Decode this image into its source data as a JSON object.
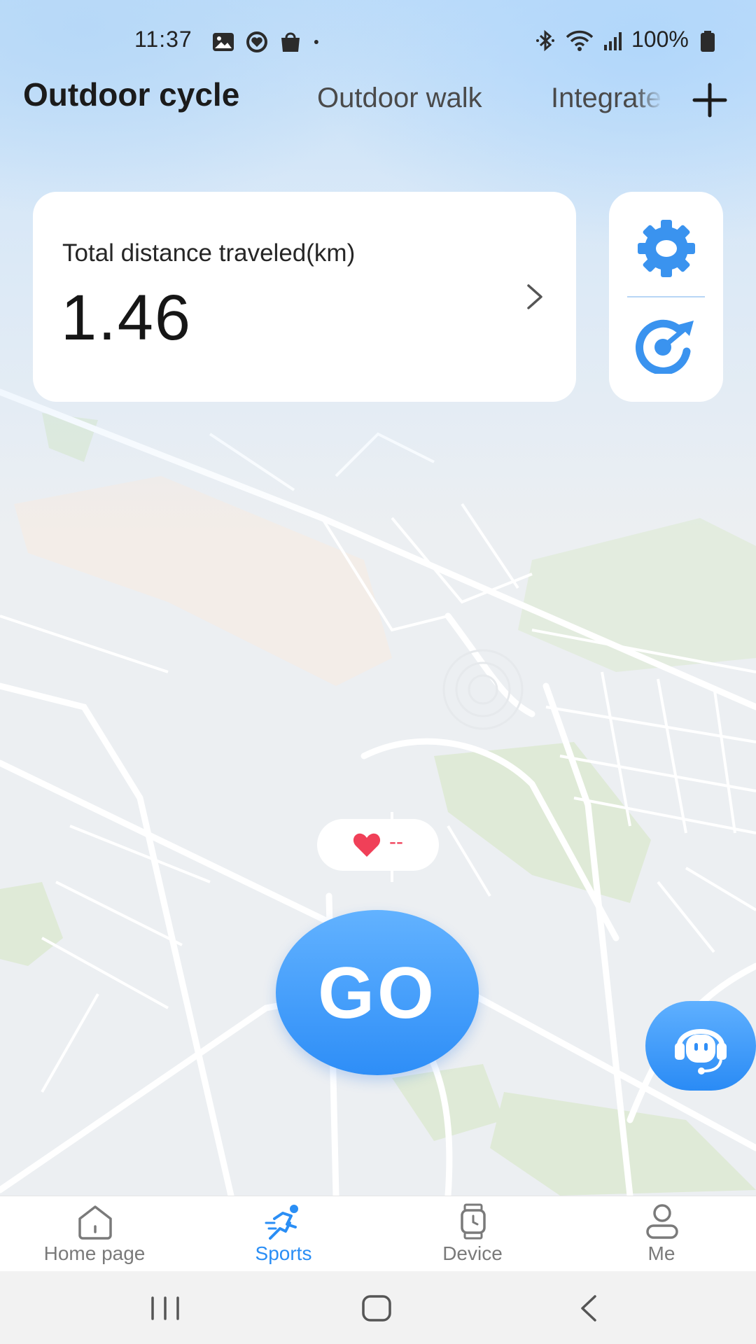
{
  "status_bar": {
    "time": "11:37",
    "battery": "100%",
    "left_icons": [
      "gallery-icon",
      "health-icon",
      "shopping-bag-icon",
      "dot-icon"
    ],
    "right_icons": [
      "bluetooth-icon",
      "wifi-icon",
      "signal-icon",
      "battery-icon"
    ]
  },
  "tabs": {
    "active": "Outdoor cycle",
    "items": [
      "Outdoor cycle",
      "Outdoor walk",
      "Integrate"
    ],
    "add_icon": "plus-icon"
  },
  "distance_card": {
    "label": "Total distance traveled(km)",
    "value": "1.46",
    "chevron_icon": "chevron-right-icon"
  },
  "side_actions": {
    "settings_icon": "gear-icon",
    "goal_icon": "target-icon"
  },
  "heart_rate": {
    "value": "--",
    "icon": "heart-icon"
  },
  "go_button": {
    "label": "GO"
  },
  "support": {
    "icon": "customer-service-icon"
  },
  "bottom_nav": {
    "items": [
      {
        "label": "Home page",
        "icon": "home-icon",
        "active": false
      },
      {
        "label": "Sports",
        "icon": "running-icon",
        "active": true
      },
      {
        "label": "Device",
        "icon": "watch-icon",
        "active": false
      },
      {
        "label": "Me",
        "icon": "person-icon",
        "active": false
      }
    ]
  },
  "system_nav": {
    "icons": [
      "recent-apps-icon",
      "home-circle-icon",
      "back-icon"
    ]
  },
  "colors": {
    "accent": "#2E8EF7",
    "heart": "#F04058",
    "map_background": "#ECEFF2",
    "map_park": "#DCE9D5",
    "map_road": "#FFFFFF"
  }
}
